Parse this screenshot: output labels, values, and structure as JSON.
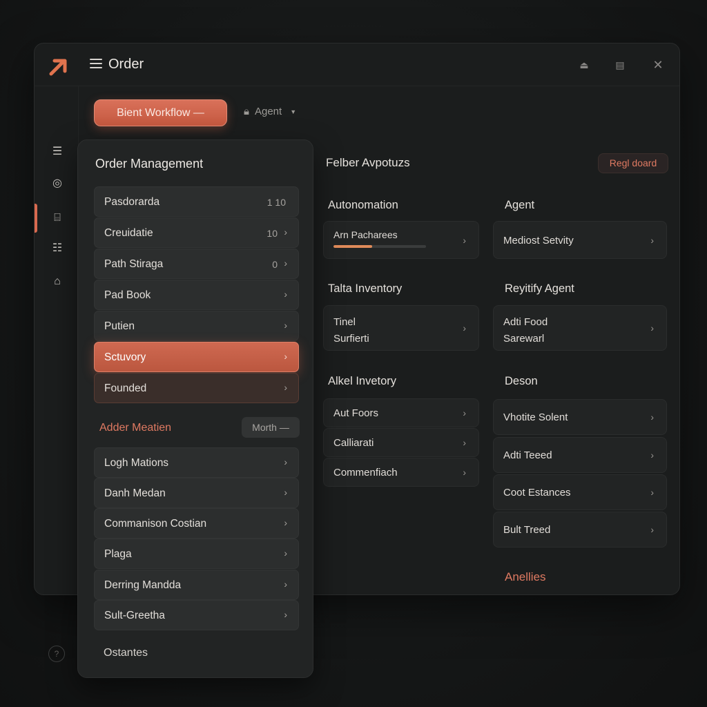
{
  "titlebar": {
    "title": "Order"
  },
  "toolbar": {
    "primary_button": "Bient Workflow —",
    "agent_label": "Agent"
  },
  "left_panel": {
    "title": "Order Management",
    "items": [
      {
        "label": "Pasdorarda",
        "count": "1 10",
        "selected": false
      },
      {
        "label": "Creuidatie",
        "count": "10",
        "selected": false
      },
      {
        "label": "Path Stiraga",
        "count": "0",
        "selected": false
      },
      {
        "label": "Pad Book",
        "count": "",
        "selected": false
      },
      {
        "label": "Putien",
        "count": "",
        "selected": false
      },
      {
        "label": "Sctuvory",
        "count": "",
        "selected": true
      },
      {
        "label": "Founded",
        "count": "",
        "selected": false
      }
    ],
    "sub_title": "Adder Meatien",
    "month_pill": "Morth —",
    "sub_items": [
      {
        "label": "Logh Mations"
      },
      {
        "label": "Danh Medan"
      },
      {
        "label": "Commanison Costian"
      },
      {
        "label": "Plaga"
      },
      {
        "label": "Derring Mandda"
      },
      {
        "label": "Sult-Greetha"
      }
    ],
    "footer_item": "Ostantes"
  },
  "right_panel": {
    "title": "Felber Avpotuzs",
    "action_button": "Regl doard",
    "sections": {
      "autonomation": {
        "title": "Autonomation",
        "card_label": "Arn Pacharees",
        "progress": 0.42,
        "progress_color": "#e08b5a"
      },
      "agent": {
        "title": "Agent",
        "card_label": "Mediost Setvity"
      },
      "talta_inventory": {
        "title": "Talta Inventory",
        "card_line1": "Tinel",
        "card_line2": "Surfierti"
      },
      "reyitify_agent": {
        "title": "Reyitify Agent",
        "card_line1": "Adti Food",
        "card_line2": "Sarewarl"
      },
      "alkel_invetory": {
        "title": "Alkel Invetory",
        "items": [
          {
            "label": "Aut Foors"
          },
          {
            "label": "Calliarati"
          },
          {
            "label": "Commenfiach"
          }
        ]
      },
      "deson": {
        "title": "Deson",
        "items": [
          {
            "label": "Vhotite Solent"
          },
          {
            "label": "Adti Teeed"
          },
          {
            "label": "Coot Estances"
          },
          {
            "label": "Bult Treed"
          }
        ]
      }
    },
    "accent_link": "Anellies"
  },
  "colors": {
    "accent": "#d8694f",
    "background": "#151717",
    "panel": "#222424"
  }
}
